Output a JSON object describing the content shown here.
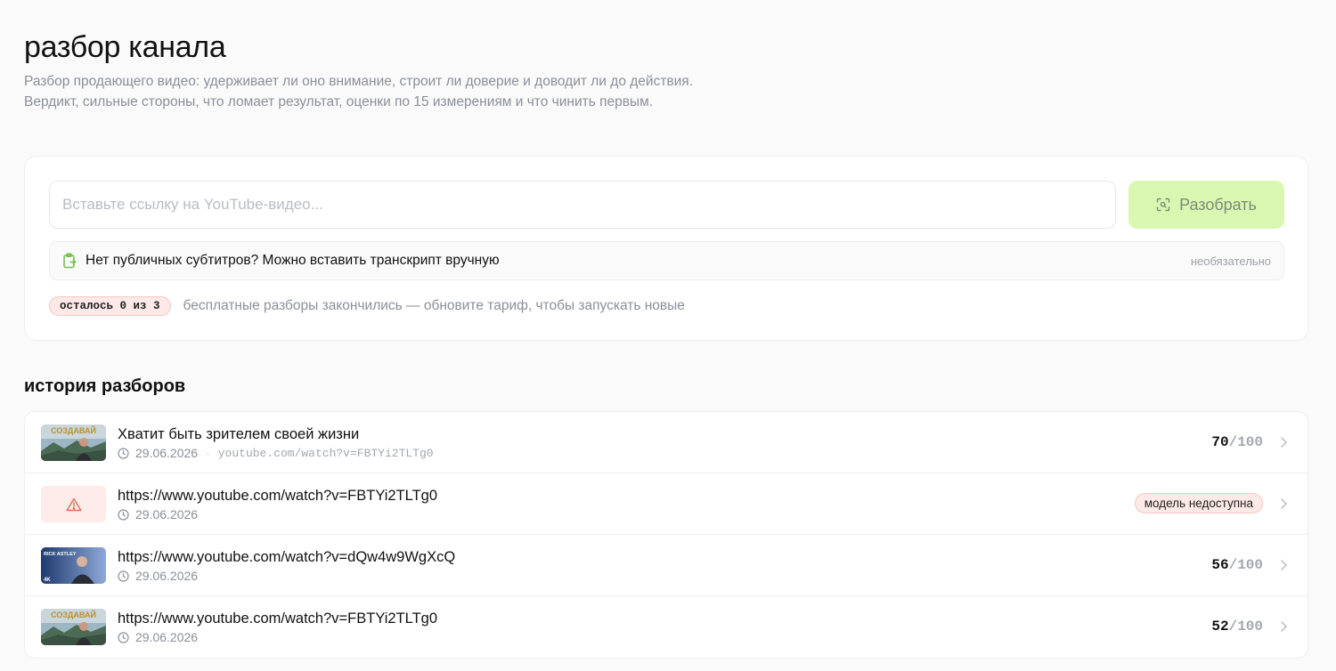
{
  "header": {
    "title": "разбор канала",
    "description": "Разбор продающего видео: удерживает ли оно внимание, строит ли доверие и доводит ли до действия. Вердикт, сильные стороны, что ломает результат, оценки по 15 измерениям и что чинить первым."
  },
  "analyze": {
    "url_placeholder": "Вставьте ссылку на YouTube-видео...",
    "url_value": "",
    "button_label": "Разобрать",
    "transcript_label": "Нет публичных субтитров? Можно вставить транскрипт вручную",
    "transcript_optional": "необязательно",
    "quota_badge": "осталось 0 из 3",
    "quota_text": "бесплатные разборы закончились — обновите тариф, чтобы запускать новые"
  },
  "history": {
    "title": "история разборов",
    "items": [
      {
        "title": "Хватит быть зрителем своей жизни",
        "date": "29.06.2026",
        "url": "youtube.com/watch?v=FBTYi2TLTg0",
        "score": "70",
        "score_max": "/100",
        "thumbnail": "sozdavai",
        "thumb_caption": "СОЗДАВАЙ"
      },
      {
        "title": "https://www.youtube.com/watch?v=FBTYi2TLTg0",
        "date": "29.06.2026",
        "status": "модель недоступна",
        "thumbnail": "warning-icon"
      },
      {
        "title": "https://www.youtube.com/watch?v=dQw4w9WgXcQ",
        "date": "29.06.2026",
        "score": "56",
        "score_max": "/100",
        "thumbnail": "rick-astley",
        "thumb_caption": "RICK ASTLEY",
        "thumb_badge": "4K"
      },
      {
        "title": "https://www.youtube.com/watch?v=FBTYi2TLTg0",
        "date": "29.06.2026",
        "score": "52",
        "score_max": "/100",
        "thumbnail": "sozdavai",
        "thumb_caption": "СОЗДАВАЙ"
      }
    ]
  },
  "colors": {
    "accent_button_bg": "#d9f7b0",
    "badge_bg": "#fde9e7",
    "badge_border": "#f5c7c1",
    "muted_text": "#8b8f99"
  }
}
